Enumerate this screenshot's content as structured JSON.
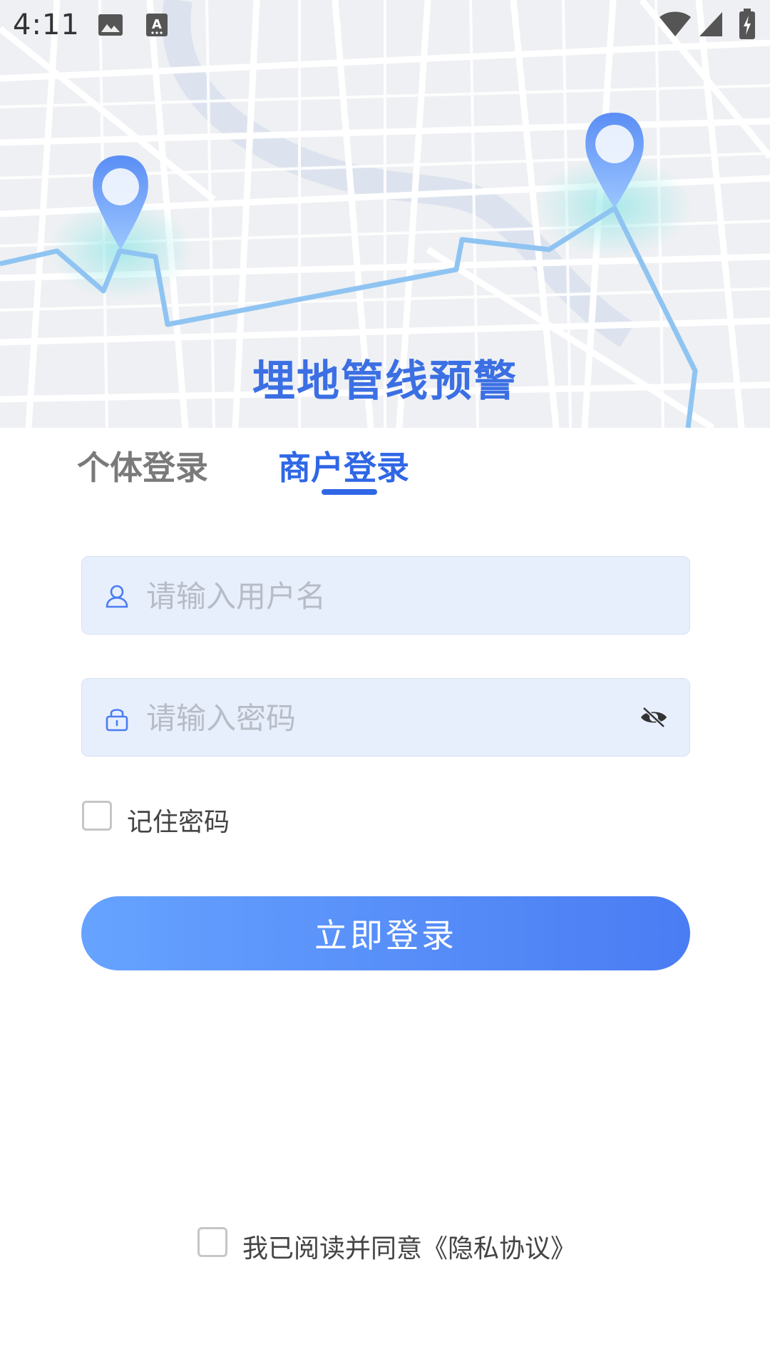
{
  "status_bar": {
    "time": "4:11",
    "icons": [
      "image-icon",
      "keyboard-a-icon",
      "wifi-icon",
      "signal-icon",
      "battery-charging-icon"
    ]
  },
  "header": {
    "title": "埋地管线预警",
    "map_icons": [
      "map-pin-icon",
      "map-pin-icon"
    ]
  },
  "tabs": [
    {
      "label": "个体登录",
      "active": false
    },
    {
      "label": "商户登录",
      "active": true
    }
  ],
  "form": {
    "username": {
      "placeholder": "请输入用户名",
      "value": "",
      "icon": "user-icon"
    },
    "password": {
      "placeholder": "请输入密码",
      "value": "",
      "icon": "lock-icon",
      "toggle_icon": "eye-off-icon"
    },
    "remember": {
      "label": "记住密码",
      "checked": false
    },
    "submit_label": "立即登录"
  },
  "agreement": {
    "prefix": "我已阅读并同意",
    "link": "《隐私协议》",
    "checked": false
  },
  "colors": {
    "accent": "#2f67e6",
    "field_bg": "#e8effc",
    "button_start": "#66a3ff",
    "button_end": "#4a7cf3",
    "tab_inactive": "#7a7a7a"
  }
}
